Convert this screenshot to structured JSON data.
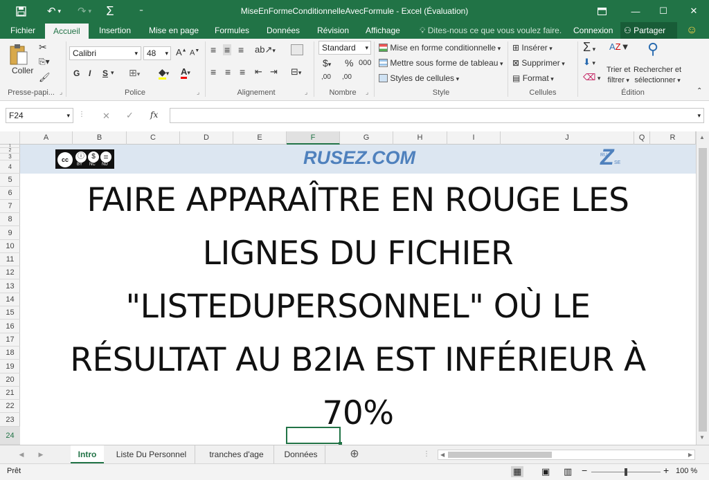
{
  "window": {
    "title": "MiseEnFormeConditionnelleAvecFormule - Excel (Évaluation)",
    "qat_more": "⁼",
    "minimize": "—",
    "maximize": "☐",
    "close": "✕"
  },
  "tabs": {
    "items": [
      "Fichier",
      "Accueil",
      "Insertion",
      "Mise en page",
      "Formules",
      "Données",
      "Révision",
      "Affichage"
    ],
    "tell_me": "Dites-nous ce que vous voulez faire.",
    "signin": "Connexion",
    "share": "Partager"
  },
  "ribbon": {
    "clipboard": {
      "paste": "Coller",
      "group": "Presse-papi..."
    },
    "font": {
      "name": "Calibri",
      "size": "48",
      "bold": "G",
      "italic": "I",
      "underline": "S",
      "grow": "A",
      "shrink": "A",
      "color_letter": "A",
      "group": "Police"
    },
    "alignment": {
      "group": "Alignement"
    },
    "number": {
      "format": "Standard",
      "currency": "$",
      "percent": "%",
      "thousands": "000",
      "inc_dec": ",00",
      "dec_dec": ",00",
      "group": "Nombre"
    },
    "styles": {
      "conditional": "Mise en forme conditionnelle",
      "table": "Mettre sous forme de tableau",
      "cell": "Styles de cellules",
      "group": "Style"
    },
    "cells": {
      "insert": "Insérer",
      "delete": "Supprimer",
      "format": "Format",
      "group": "Cellules"
    },
    "editing": {
      "sort_1": "Trier et",
      "sort_2": "filtrer",
      "find_1": "Rechercher et",
      "find_2": "sélectionner",
      "group": "Édition"
    }
  },
  "formula_bar": {
    "name_box": "F24",
    "value": "",
    "cancel": "✕",
    "enter": "✓",
    "fx": "fx"
  },
  "columns": [
    "A",
    "B",
    "C",
    "D",
    "E",
    "F",
    "G",
    "H",
    "I",
    "J",
    "Q",
    "R"
  ],
  "rows": [
    "1",
    "2",
    "3",
    "4",
    "5",
    "6",
    "7",
    "8",
    "9",
    "10",
    "11",
    "12",
    "13",
    "14",
    "15",
    "16",
    "17",
    "18",
    "19",
    "20",
    "21",
    "22",
    "23",
    "24"
  ],
  "sheet": {
    "site": "RUSEZ.COM",
    "cc_labels": [
      "BY",
      "NC",
      "ND"
    ],
    "logo_letter": "Z",
    "logo_small_1": "RU",
    "logo_small_2": "SE",
    "heading_lines": [
      "FAIRE APPARAÎTRE EN ROUGE LES",
      "LIGNES DU FICHIER",
      "\"LISTEDUPERSONNEL\" OÙ LE",
      "RÉSULTAT AU B2IA EST INFÉRIEUR À",
      "70%"
    ]
  },
  "sheet_tabs": [
    "Intro",
    "Liste Du Personnel",
    "tranches d'age",
    "Données"
  ],
  "status": {
    "ready": "Prêt",
    "zoom": "100 %",
    "minus": "−",
    "plus": "+"
  },
  "colors": {
    "brand": "#217346",
    "banner": "#dce6f1",
    "site": "#4f81bd"
  }
}
